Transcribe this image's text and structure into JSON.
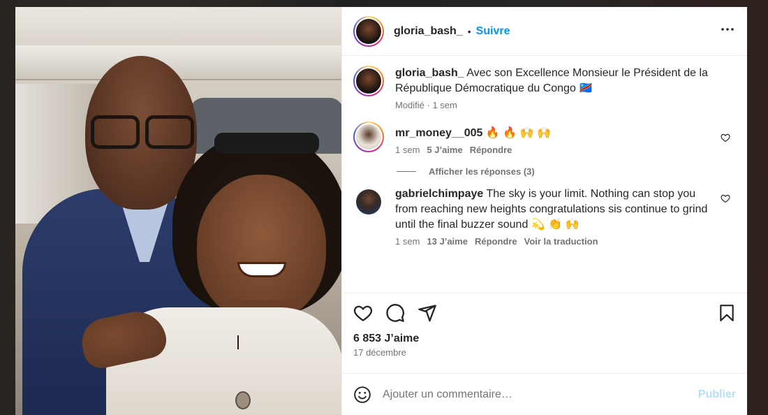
{
  "post": {
    "username": "gloria_bash_",
    "separator": "•",
    "follow_label": "Suivre",
    "more_label": "•••",
    "caption": {
      "username": "gloria_bash_",
      "text": "Avec son Excellence Monsieur le Président de la République Démocratique du Congo 🇨🇩",
      "meta": "Modifié · 1 sem"
    },
    "comments": [
      {
        "username": "mr_money__005",
        "text": "🔥 🔥 🙌 🙌",
        "time": "1 sem",
        "likes": "5 J’aime",
        "reply": "Répondre",
        "view_replies": "Afficher les réponses (3)"
      },
      {
        "username": "gabrielchimpaye",
        "text": "The sky is your limit. Nothing can stop you from reaching new heights congratulations sis continue to grind until the final buzzer sound 💫 👏 🙌",
        "time": "1 sem",
        "likes": "13 J’aime",
        "reply": "Répondre",
        "translate": "Voir la traduction"
      }
    ],
    "like_count": "6 853 J’aime",
    "date": "17 décembre",
    "comment_placeholder": "Ajouter un commentaire…",
    "publish_label": "Publier"
  },
  "colors": {
    "accent": "#0095f6",
    "text": "#262626",
    "muted": "#737373",
    "publish_disabled": "#b2dffc"
  },
  "icons": [
    "more-icon",
    "heart-icon",
    "comment-icon",
    "share-icon",
    "bookmark-icon",
    "emoji-icon"
  ]
}
